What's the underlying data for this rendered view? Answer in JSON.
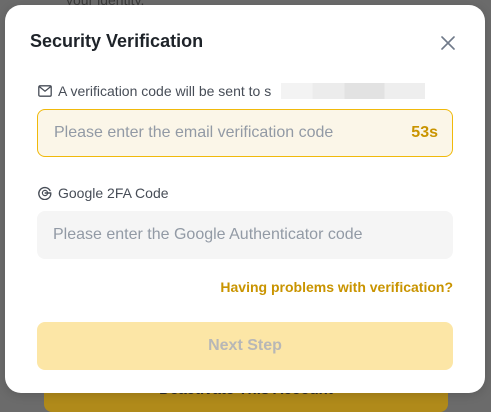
{
  "background": {
    "top_text": "your identity.",
    "button_label": "Deactivate This Account"
  },
  "modal": {
    "title": "Security Verification",
    "close_icon": "close-icon",
    "email_section": {
      "label": "A verification code will be sent to s",
      "icon": "mail-icon",
      "placeholder": "Please enter the email verification code",
      "countdown": "53s"
    },
    "google_section": {
      "label": "Google 2FA Code",
      "icon": "google-icon",
      "placeholder": "Please enter the Google Authenticator code"
    },
    "help_link": "Having problems with verification?",
    "next_button": "Next Step"
  },
  "colors": {
    "accent": "#f0b90b",
    "link": "#c99400",
    "disabled_button": "#fce6a6"
  }
}
